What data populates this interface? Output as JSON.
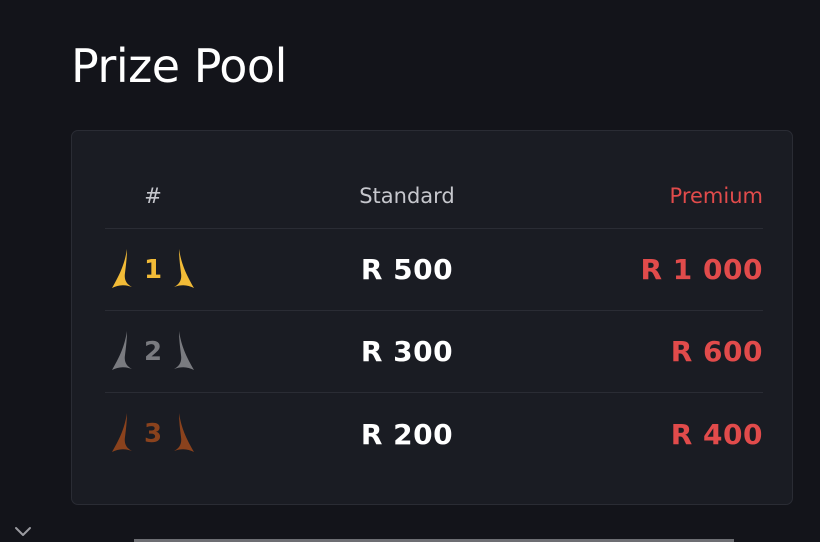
{
  "page": {
    "title": "Prize Pool"
  },
  "table": {
    "headers": {
      "rank": "#",
      "standard": "Standard",
      "premium": "Premium"
    },
    "rows": [
      {
        "rank": "1",
        "standard": "R 500",
        "premium": "R 1 000",
        "medal_color": "#f2bb37"
      },
      {
        "rank": "2",
        "standard": "R 300",
        "premium": "R 600",
        "medal_color": "#7a7b80"
      },
      {
        "rank": "3",
        "standard": "R 200",
        "premium": "R 400",
        "medal_color": "#8a421d"
      }
    ]
  },
  "colors": {
    "background": "#13141a",
    "card": "#1a1c23",
    "accent_red": "#e14b4b"
  },
  "icons": {
    "laurel": "laurel-icon",
    "collapse": "chevron-down-icon"
  }
}
